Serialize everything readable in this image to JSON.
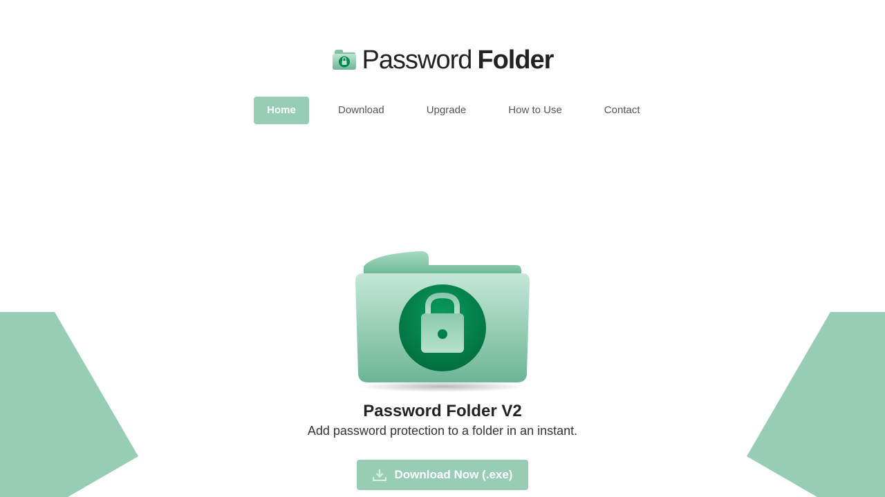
{
  "colors": {
    "accent": "#97cdb4",
    "accent_dark": "#00804a",
    "text": "#222222",
    "nav_text": "#555555"
  },
  "brand": {
    "name_light": "Password",
    "name_bold": "Folder",
    "icon": "locked-folder-icon"
  },
  "nav": {
    "items": [
      {
        "label": "Home",
        "active": true
      },
      {
        "label": "Download",
        "active": false
      },
      {
        "label": "Upgrade",
        "active": false
      },
      {
        "label": "How to Use",
        "active": false
      },
      {
        "label": "Contact",
        "active": false
      }
    ]
  },
  "hero": {
    "icon": "locked-folder-icon",
    "title": "Password Folder V2",
    "tagline": "Add password protection to a folder in an instant.",
    "download_button": {
      "icon": "download-icon",
      "label": "Download Now (.exe)"
    }
  }
}
